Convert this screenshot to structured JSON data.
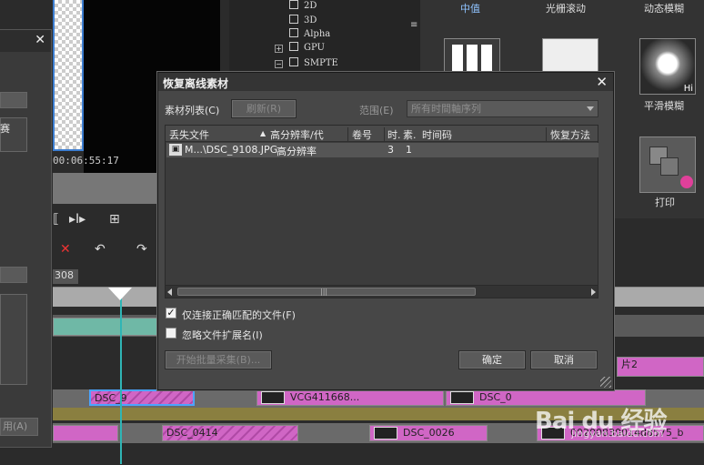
{
  "left_panel": {
    "close": "✕",
    "label": "赛",
    "apply": "用(A)"
  },
  "preview": {
    "timecode": "00:06:55:17"
  },
  "tree": {
    "items": [
      "2D",
      "3D",
      "Alpha",
      "GPU",
      "SMPTE"
    ]
  },
  "effects": {
    "titles": [
      "中值",
      "光栅滚动",
      "动态模糊"
    ],
    "labels": [
      "平滑模糊",
      "打印"
    ],
    "hi_badge": "Hi"
  },
  "timeline": {
    "seq_tab": "308",
    "clips_row1": [
      {
        "name": "DSC_9"
      },
      {
        "name": "VCG411668..."
      },
      {
        "name": "DSC_0"
      },
      {
        "name": "片2"
      }
    ],
    "clips_row2": [
      {
        "name": "DSC_0414"
      },
      {
        "name": "DSC_0026"
      },
      {
        "name": "00200830014d8575_b"
      }
    ]
  },
  "dialog": {
    "title": "恢复离线素材",
    "close": "✕",
    "clip_list_label": "素材列表(C)",
    "refresh_button": "刷新(R)",
    "scope_label": "范围(E)",
    "scope_value": "所有时間軸序列",
    "columns": [
      "丢失文件",
      "高分辨率/代",
      "卷号",
      "时.",
      "素.",
      "时间码",
      "恢复方法"
    ],
    "rows": [
      {
        "file": "M...\\DSC_9108.JPG",
        "resolution": "高分辨率",
        "reel": "",
        "t": "3",
        "s": "1",
        "timecode": "",
        "method": ""
      }
    ],
    "opt_match": "仅连接正确匹配的文件(F)",
    "opt_match_checked": true,
    "opt_ignore_ext": "忽略文件扩展名(I)",
    "opt_ignore_ext_checked": false,
    "batch_button": "开始批量采集(B)...",
    "ok_button": "确定",
    "cancel_button": "取消"
  },
  "watermark": {
    "logo": "Bai du 经验",
    "url": "jingyan.baidu.com"
  }
}
